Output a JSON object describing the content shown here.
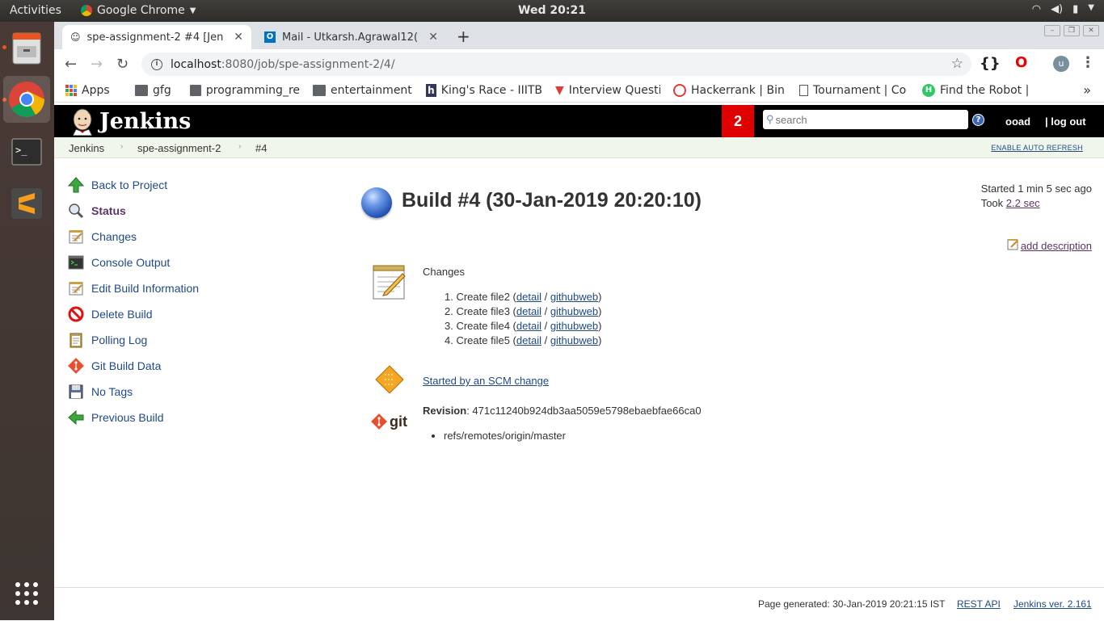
{
  "os": {
    "activities": "Activities",
    "app_name": "Google Chrome",
    "clock": "Wed 20:21"
  },
  "browser": {
    "tabs": [
      {
        "title": "spe-assignment-2 #4 [Jen"
      },
      {
        "title": "Mail - Utkarsh.Agrawal12("
      }
    ],
    "url_host": "localhost",
    "url_path": ":8080/job/spe-assignment-2/4/",
    "profile_initial": "u",
    "bookmarks": [
      {
        "label": "Apps",
        "icon": "apps-grid-icon"
      },
      {
        "label": "gfg",
        "icon": "folder-icon"
      },
      {
        "label": "programming_re",
        "icon": "folder-icon"
      },
      {
        "label": "entertainment",
        "icon": "folder-icon"
      },
      {
        "label": "King's Race - IIITB",
        "icon": "hackerearth-icon"
      },
      {
        "label": "Interview Questi",
        "icon": "interview-icon"
      },
      {
        "label": "Hackerrank | Bin",
        "icon": "hackerrank-icon"
      },
      {
        "label": "Tournament | Co",
        "icon": "page-icon"
      },
      {
        "label": "Find the Robot |",
        "icon": "hackerrank-green-icon"
      }
    ]
  },
  "jenkins": {
    "logo_text": "Jenkins",
    "notification_count": "2",
    "search_placeholder": "search",
    "user": "ooad",
    "logout": "| log out",
    "breadcrumbs": [
      "Jenkins",
      "spe-assignment-2",
      "#4"
    ],
    "auto_refresh": "ENABLE AUTO REFRESH",
    "tasks": [
      {
        "label": "Back to Project",
        "icon": "up-arrow-icon"
      },
      {
        "label": "Status",
        "icon": "magnifier-icon"
      },
      {
        "label": "Changes",
        "icon": "notepad-icon"
      },
      {
        "label": "Console Output",
        "icon": "terminal-icon"
      },
      {
        "label": "Edit Build Information",
        "icon": "notepad-icon"
      },
      {
        "label": "Delete Build",
        "icon": "no-entry-icon"
      },
      {
        "label": "Polling Log",
        "icon": "clipboard-icon"
      },
      {
        "label": "Git Build Data",
        "icon": "git-icon"
      },
      {
        "label": "No Tags",
        "icon": "floppy-icon"
      },
      {
        "label": "Previous Build",
        "icon": "left-arrow-icon"
      }
    ],
    "build": {
      "title": "Build #4 (30-Jan-2019 20:20:10)",
      "started": "Started 1 min 5 sec ago",
      "took_label": "Took ",
      "took_value": "2.2 sec",
      "add_description": "add description",
      "changes_label": "Changes",
      "changes": [
        {
          "num": "1.",
          "text": "Create file2 (",
          "detail": "detail",
          "sep": " / ",
          "web": "githubweb",
          "end": ")"
        },
        {
          "num": "2.",
          "text": "Create file3 (",
          "detail": "detail",
          "sep": " / ",
          "web": "githubweb",
          "end": ")"
        },
        {
          "num": "3.",
          "text": "Create file4 (",
          "detail": "detail",
          "sep": " / ",
          "web": "githubweb",
          "end": ")"
        },
        {
          "num": "4.",
          "text": "Create file5 (",
          "detail": "detail",
          "sep": " / ",
          "web": "githubweb",
          "end": ")"
        }
      ],
      "cause": "Started by an SCM change",
      "revision_label": "Revision",
      "revision_value": ": 471c11240b924db3aa5059e5798ebaebfae66ca0",
      "git_text": "git",
      "ref": "refs/remotes/origin/master"
    },
    "footer": {
      "generated": "Page generated: 30-Jan-2019 20:21:15 IST",
      "rest_api": "REST API",
      "version": "Jenkins ver. 2.161"
    }
  }
}
